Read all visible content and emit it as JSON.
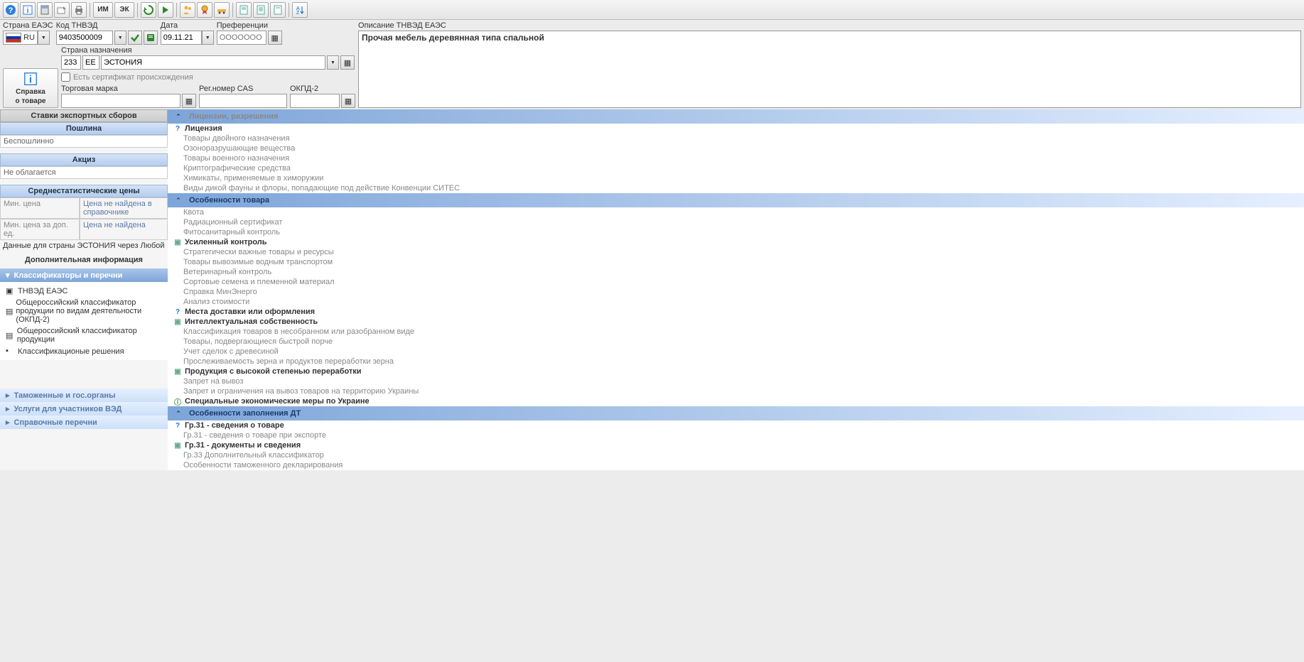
{
  "toolbar": {
    "im_label": "ИМ",
    "ek_label": "ЭК"
  },
  "header": {
    "country_eaes_label": "Страна ЕАЭС",
    "country_eaes_value": "RU",
    "tnved_label": "Код ТНВЭД",
    "tnved_value": "9403500009",
    "date_label": "Дата",
    "date_value": "09.11.21",
    "pref_label": "Преференции",
    "pref_placeholder": "ООООООО",
    "dest_label": "Страна назначения",
    "dest_code": "233",
    "dest_cc": "EE",
    "dest_name": "ЭСТОНИЯ",
    "cert_label": "Есть сертификат происхождения",
    "trade_mark_label": "Торговая марка",
    "cas_label": "Рег.номер CAS",
    "okpd_label": "ОКПД-2",
    "desc_label": "Описание ТНВЭД ЕАЭС",
    "desc_value": "Прочая мебель деревянная типа спальной",
    "info_btn_line1": "Справка",
    "info_btn_line2": "о товаре"
  },
  "left": {
    "export_rates_title": "Ставки экспортных сборов",
    "duty_title": "Пошлина",
    "duty_value": "Беспошлинно",
    "excise_title": "Акциз",
    "excise_value": "Не облагается",
    "avg_prices_title": "Среднестатистические цены",
    "min_price_label": "Мин. цена",
    "min_price_value": "Цена не найдена в справочнике",
    "min_price_add_label": "Мин. цена за доп. ед.",
    "min_price_add_value": "Цена не найдена",
    "country_note": "Данные для страны ЭСТОНИЯ через Любой",
    "add_info_title": "Дополнительная информация",
    "acc1_title": "Классификаторы и перечни",
    "acc1_items": [
      "ТНВЭД ЕАЭС",
      "Общероссийский классификатор продукции по видам деятельности (ОКПД-2)",
      "Общероссийский классификатор продукции",
      "Классификационые решения"
    ],
    "acc2_title": "Таможенные и гос.органы",
    "acc3_title": "Услуги для участников ВЭД",
    "acc4_title": "Справочные перечни"
  },
  "right": {
    "groups": [
      {
        "title": "Лицензии, разрешения",
        "title_muted": true,
        "items": [
          {
            "text": "Лицензия",
            "style": "hdr",
            "icon": "help"
          },
          {
            "text": "Товары двойного назначения",
            "style": "muted"
          },
          {
            "text": "Озоноразрушающие вещества",
            "style": "muted"
          },
          {
            "text": "Товары военного назначения",
            "style": "muted"
          },
          {
            "text": "Криптографические средства",
            "style": "muted"
          },
          {
            "text": "Химикаты, применяемые в химоружии",
            "style": "muted"
          },
          {
            "text": "Виды дикой фауны и флоры, попадающие под действие Конвенции СИТЕС",
            "style": "muted"
          }
        ]
      },
      {
        "title": "Особенности товара",
        "items": [
          {
            "text": "Квота",
            "style": "muted"
          },
          {
            "text": "Радиационный сертификат",
            "style": "muted"
          },
          {
            "text": "Фитосанитарный контроль",
            "style": "muted"
          },
          {
            "text": "Усиленный контроль",
            "style": "hdr",
            "icon": "doc"
          },
          {
            "text": "Стратегически важные товары и ресурсы",
            "style": "muted"
          },
          {
            "text": "Товары вывозимые водным транспортом",
            "style": "muted"
          },
          {
            "text": "Ветеринарный контроль",
            "style": "muted"
          },
          {
            "text": "Сортовые семена и племенной материал",
            "style": "muted"
          },
          {
            "text": "Справка МинЭнерго",
            "style": "muted"
          },
          {
            "text": "Анализ стоимости",
            "style": "muted"
          },
          {
            "text": "Места доставки или оформления",
            "style": "hdr",
            "icon": "help"
          },
          {
            "text": "Интеллектуальная собственность",
            "style": "hdr",
            "icon": "doc"
          },
          {
            "text": "Классификация товаров в несобранном или разобранном виде",
            "style": "muted"
          },
          {
            "text": "Товары, подвергающиеся быстрой порче",
            "style": "muted"
          },
          {
            "text": "Учет сделок с древесиной",
            "style": "muted"
          },
          {
            "text": "Прослеживаемость зерна и продуктов переработки зерна",
            "style": "muted"
          },
          {
            "text": "Продукция с высокой степенью переработки",
            "style": "hdr",
            "icon": "doc"
          },
          {
            "text": "Запрет на вывоз",
            "style": "muted"
          },
          {
            "text": "Запрет и ограничения на вывоз товаров на территорию Украины",
            "style": "muted"
          },
          {
            "text": "Специальные экономические меры по Украине",
            "style": "hdr",
            "icon": "info"
          }
        ]
      },
      {
        "title": "Особенности заполнения ДТ",
        "items": [
          {
            "text": "Гр.31 - сведения о товаре",
            "style": "hdr",
            "icon": "help"
          },
          {
            "text": "Гр.31 - сведения о товаре при экспорте",
            "style": "muted"
          },
          {
            "text": "Гр.31 - документы и сведения",
            "style": "hdr",
            "icon": "doc"
          },
          {
            "text": "Гр.33 Дополнительный классификатор",
            "style": "muted"
          },
          {
            "text": "Особенности таможенного декларирования",
            "style": "muted"
          }
        ]
      }
    ]
  }
}
